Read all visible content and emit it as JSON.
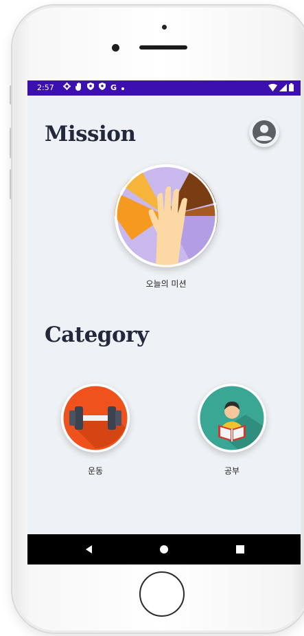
{
  "status_bar": {
    "time": "2:57",
    "icons": [
      "gear-icon",
      "hand-icon",
      "shield-icon",
      "shield-icon",
      "google-icon",
      "dot-icon"
    ],
    "google_letter": "G",
    "right_icons": [
      "wifi-icon",
      "signal-icon",
      "battery-icon"
    ],
    "color": "#3c0fb0"
  },
  "mission": {
    "title": "Mission",
    "item_label": "오늘의 미션",
    "icon": "hands-together-icon"
  },
  "category": {
    "title": "Category",
    "items": [
      {
        "label": "운동",
        "icon": "dumbbell-icon",
        "color": "#f0521d"
      },
      {
        "label": "공부",
        "icon": "student-reading-icon",
        "color": "#3aa694"
      }
    ]
  },
  "profile": {
    "icon": "account-circle-icon"
  },
  "nav_bar": {
    "items": [
      "back-icon",
      "home-icon",
      "recents-icon"
    ]
  }
}
